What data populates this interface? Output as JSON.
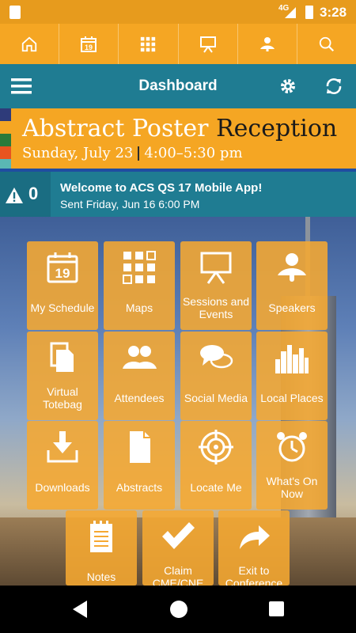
{
  "status_bar": {
    "network": "4G",
    "time": "3:28"
  },
  "top_nav": {
    "items": [
      {
        "icon": "home-icon"
      },
      {
        "icon": "calendar-icon",
        "day": "19"
      },
      {
        "icon": "grid-map-icon"
      },
      {
        "icon": "easel-icon"
      },
      {
        "icon": "speaker-icon"
      },
      {
        "icon": "search-icon"
      }
    ]
  },
  "header": {
    "title": "Dashboard"
  },
  "banner": {
    "headline_part1": "Abstract Poster",
    "headline_part2": "Reception",
    "date": "Sunday, July 23",
    "time": "4:00–5:30 pm",
    "stripe_colors": [
      "#2e3b7a",
      "#f5a623",
      "#2a7a3a",
      "#e8541f",
      "#5ab7b4"
    ]
  },
  "alert": {
    "count": "0",
    "message": "Welcome to ACS QS 17 Mobile App!",
    "sent": "Sent Friday, Jun 16 6:00 PM"
  },
  "tiles": [
    {
      "label": "My Schedule",
      "icon": "calendar-icon",
      "day": "19"
    },
    {
      "label": "Maps",
      "icon": "map-grid-icon"
    },
    {
      "label": "Sessions and Events",
      "icon": "easel-icon"
    },
    {
      "label": "Speakers",
      "icon": "speaker-icon"
    },
    {
      "label": "Virtual Totebag",
      "icon": "documents-icon"
    },
    {
      "label": "Attendees",
      "icon": "people-icon"
    },
    {
      "label": "Social Media",
      "icon": "chat-bubbles-icon"
    },
    {
      "label": "Local Places",
      "icon": "city-icon"
    },
    {
      "label": "Downloads",
      "icon": "download-icon"
    },
    {
      "label": "Abstracts",
      "icon": "document-icon"
    },
    {
      "label": "Locate Me",
      "icon": "target-icon"
    },
    {
      "label": "What's On Now",
      "icon": "alarm-clock-icon"
    },
    {
      "label": "Notes",
      "icon": "notepad-icon"
    },
    {
      "label": "Claim CME/CNE",
      "icon": "checkmark-icon"
    },
    {
      "label": "Exit to Conference",
      "icon": "share-arrow-icon"
    }
  ],
  "colors": {
    "orange": "#f5a623",
    "teal": "#1f7c92",
    "tile": "#f6a831"
  }
}
